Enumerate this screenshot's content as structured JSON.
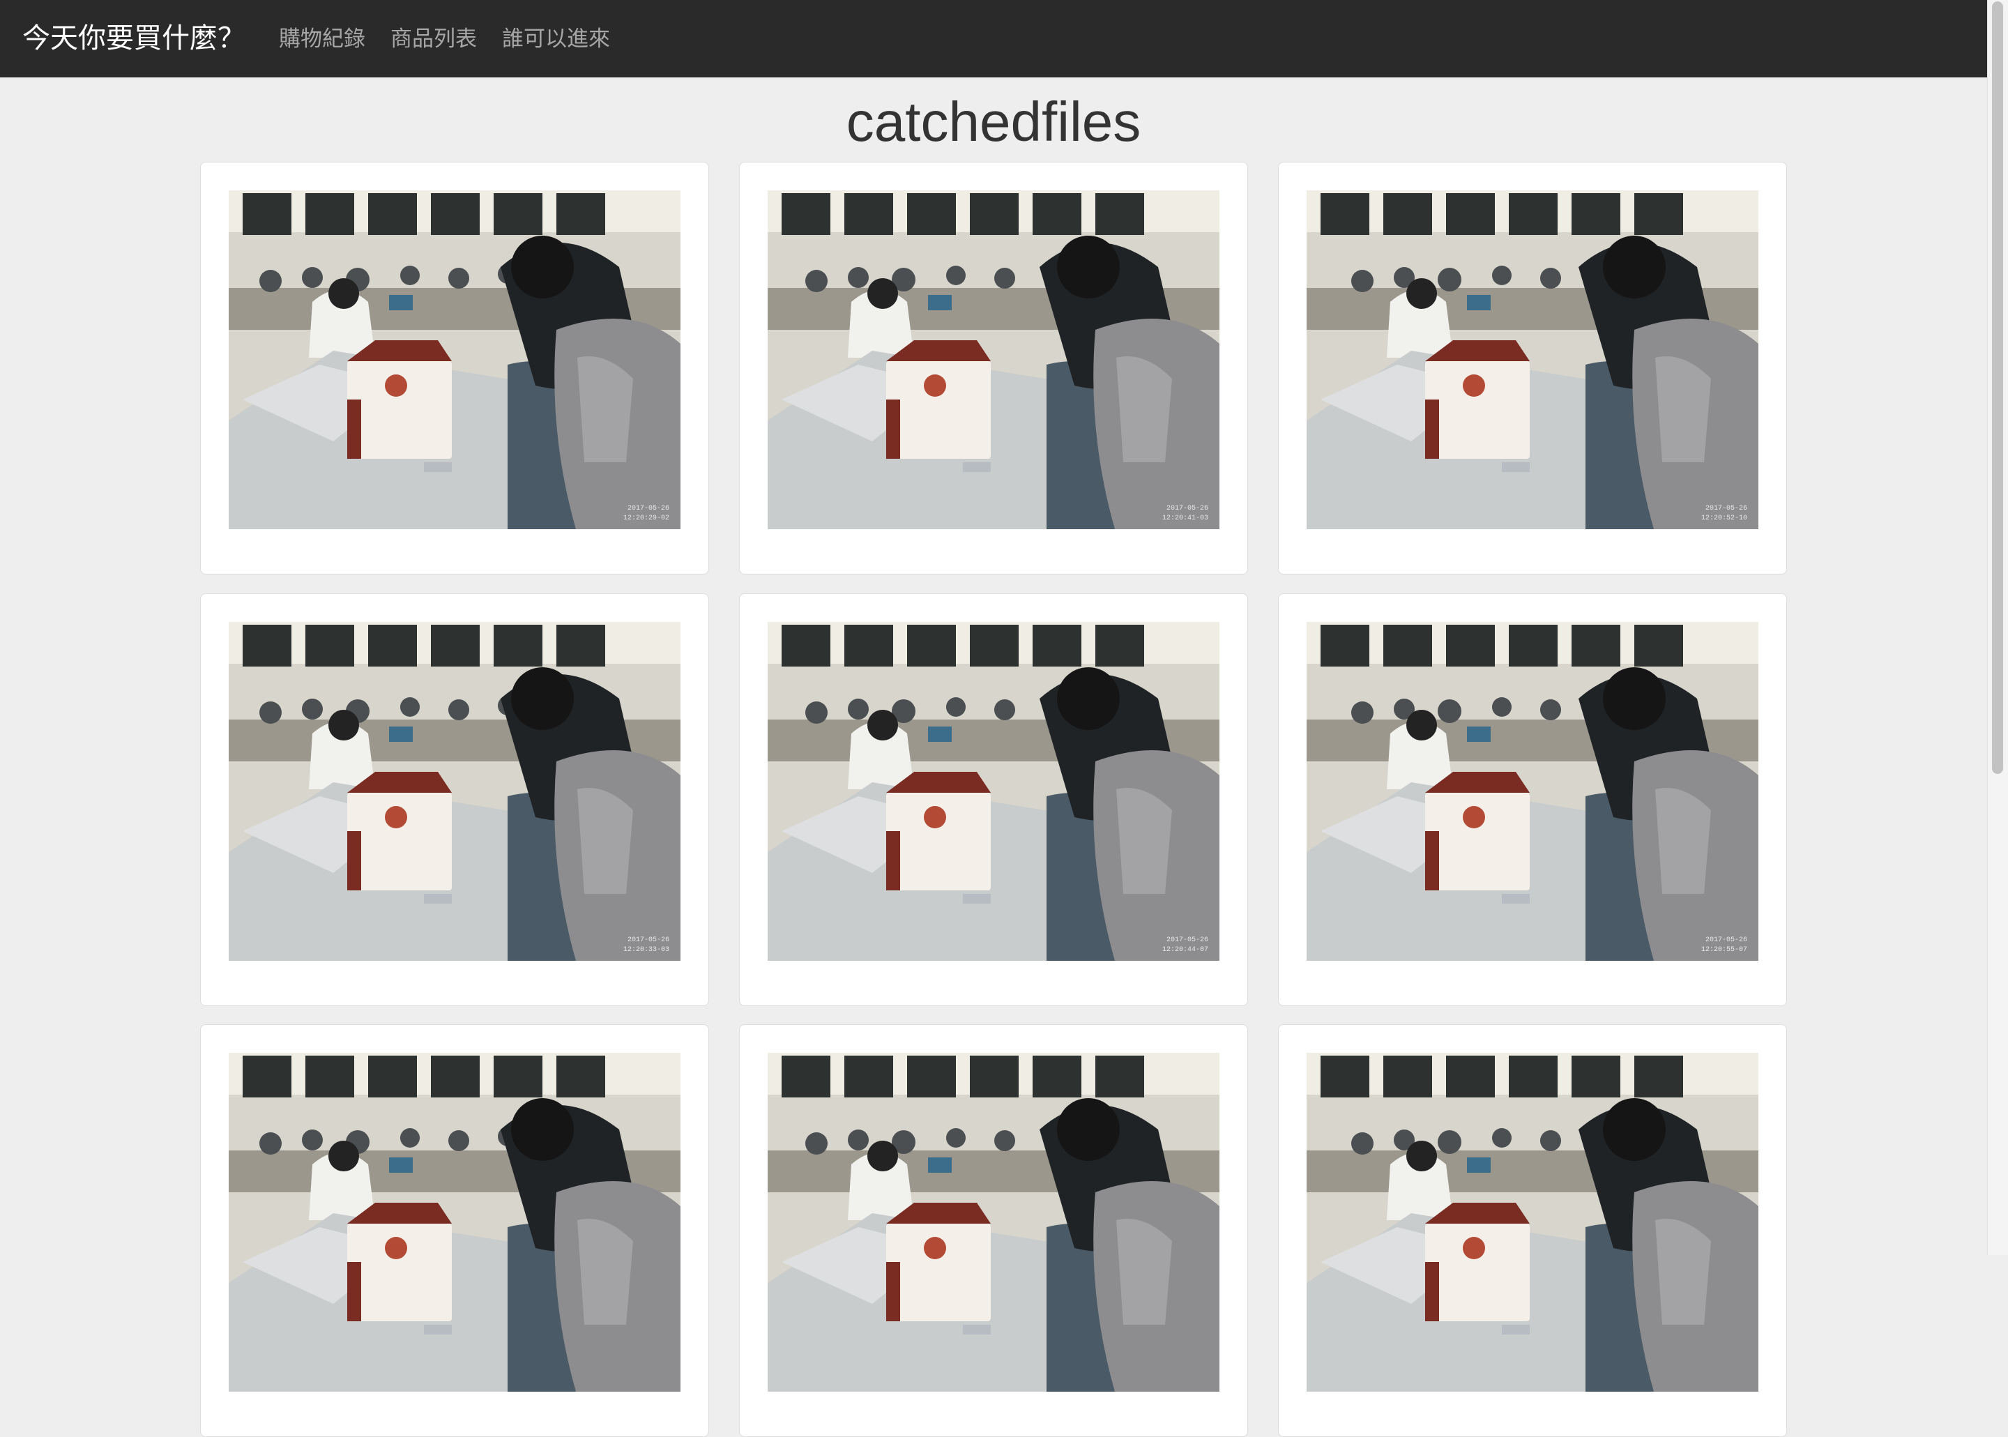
{
  "navbar": {
    "brand": "今天你要買什麼？",
    "links": [
      {
        "label": "購物紀錄"
      },
      {
        "label": "商品列表"
      },
      {
        "label": "誰可以進來"
      }
    ]
  },
  "page": {
    "title": "catchedfiles"
  },
  "gallery": {
    "photos": [
      {
        "timestamp": "2017-05-26 12:20:29-02"
      },
      {
        "timestamp": "2017-05-26 12:20:41-03"
      },
      {
        "timestamp": "2017-05-26 12:20:52-10"
      },
      {
        "timestamp": "2017-05-26 12:20:33-03"
      },
      {
        "timestamp": "2017-05-26 12:20:44-07"
      },
      {
        "timestamp": "2017-05-26 12:20:55-07"
      },
      {
        "timestamp": ""
      },
      {
        "timestamp": ""
      },
      {
        "timestamp": ""
      }
    ]
  },
  "colors": {
    "navbar_bg": "#2a2a2a",
    "page_bg": "#eeeeee",
    "card_bg": "#ffffff"
  }
}
